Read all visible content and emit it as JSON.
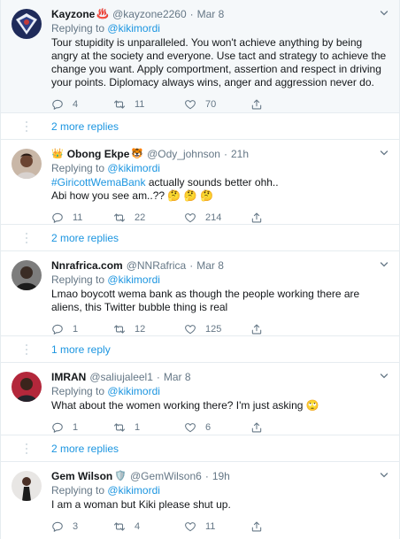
{
  "common": {
    "replying_label": "Replying to",
    "replying_user": "@kikimordi",
    "dot": "·"
  },
  "tweets": [
    {
      "name": "Kayzone",
      "name_emoji": "♨️",
      "handle": "@kayzone2260",
      "time": "Mar 8",
      "text": "Tour stupidity is unparalleled. You won't achieve anything by being angry at the society and everyone. Use tact and strategy to achieve the change you want. Apply comportment, assertion and respect in driving your points. Diplomacy always wins, anger and aggression never do.",
      "replies": "4",
      "retweets": "11",
      "likes": "70",
      "more": "2 more replies"
    },
    {
      "name": "Obong Ekpe",
      "name_emoji_lead": "👑",
      "name_emoji": "🐯",
      "handle": "@Ody_johnson",
      "time": "21h",
      "hashtag": "#GiricottWemaBank",
      "text_a": " actually sounds better ohh..",
      "text_b": "Abi how you see am..??",
      "text_emojis": "🤔 🤔 🤔",
      "replies": "11",
      "retweets": "22",
      "likes": "214",
      "more": "2 more replies"
    },
    {
      "name": "Nnrafrica.com",
      "handle": "@NNRafrica",
      "time": "Mar 8",
      "text": "Lmao boycott wema bank as though the people working there are aliens, this Twitter bubble thing is real",
      "replies": "1",
      "retweets": "12",
      "likes": "125",
      "more": "1 more reply"
    },
    {
      "name": "IMRAN",
      "handle": "@saliujaleel1",
      "time": "Mar 8",
      "text": "What about the women working there? I'm just asking",
      "text_emojis": "🙄",
      "replies": "1",
      "retweets": "1",
      "likes": "6",
      "more": "2 more replies"
    },
    {
      "name": "Gem Wilson",
      "name_emoji": "🛡️",
      "handle": "@GemWilson6",
      "time": "19h",
      "text": "I am a woman but Kiki please shut up.",
      "replies": "3",
      "retweets": "4",
      "likes": "11"
    }
  ],
  "icons": {
    "reply": "reply-icon",
    "retweet": "retweet-icon",
    "like": "heart-icon",
    "share": "share-icon",
    "caret": "chevron-down-icon"
  },
  "colors": {
    "link": "#1b95e0",
    "muted": "#657786",
    "text": "#14171a",
    "highlight_bg": "#f5f8fa",
    "border": "#e6ecf0"
  }
}
